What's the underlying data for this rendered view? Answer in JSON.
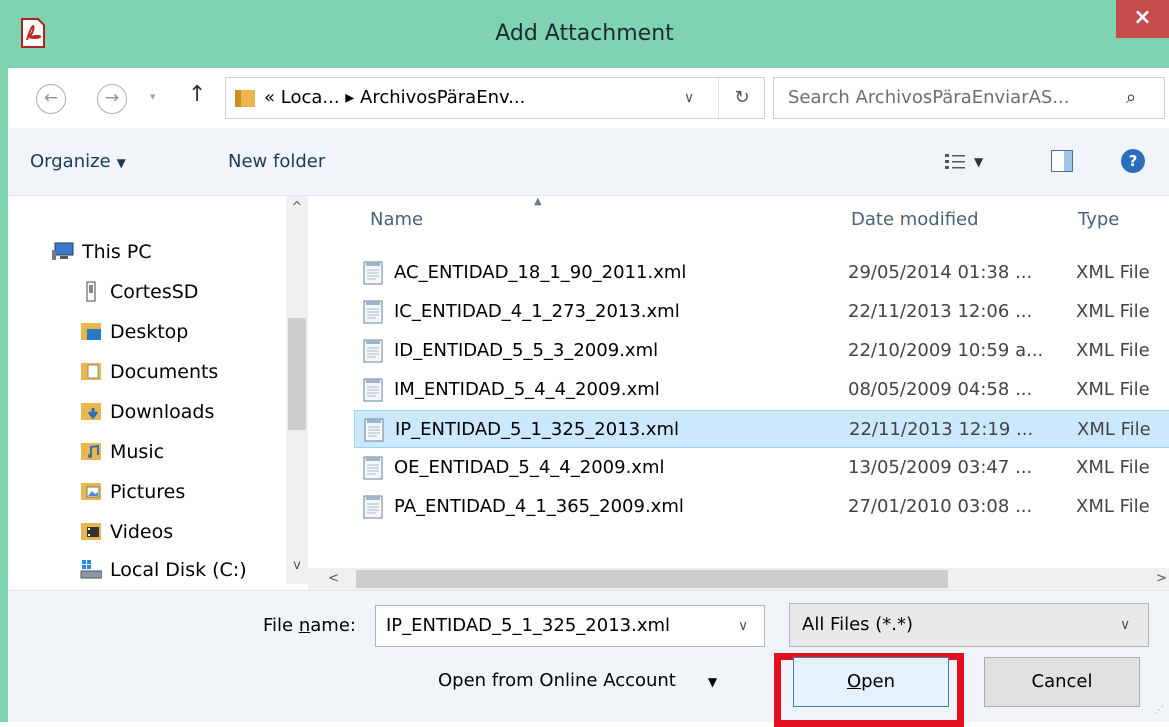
{
  "window": {
    "title": "Add Attachment",
    "close_glyph": "×",
    "app_icon": "pdf-document-icon",
    "accent": "#7fd3b0"
  },
  "navigation": {
    "back_glyph": "←",
    "forward_glyph": "→",
    "recent_glyph": "▾",
    "up_glyph": "↑",
    "address_path": "« Loca... ▸ ArchivosPäraEnv...",
    "address_dropdown_glyph": "∨",
    "refresh_glyph": "↻",
    "search_placeholder": "Search ArchivosPäraEnviarAS...",
    "search_glyph": "⌕"
  },
  "toolbar": {
    "organize": "Organize",
    "organize_caret": "▼",
    "new_folder": "New folder",
    "view_caret": "▼",
    "help_glyph": "?"
  },
  "sidebar": {
    "scroll_up": "^",
    "scroll_down": "v",
    "items": [
      {
        "label": "This PC",
        "icon": "computer-icon"
      },
      {
        "label": "CortesSD",
        "icon": "usb-drive-icon"
      },
      {
        "label": "Desktop",
        "icon": "desktop-folder-icon"
      },
      {
        "label": "Documents",
        "icon": "documents-folder-icon"
      },
      {
        "label": "Downloads",
        "icon": "downloads-folder-icon"
      },
      {
        "label": "Music",
        "icon": "music-folder-icon"
      },
      {
        "label": "Pictures",
        "icon": "pictures-folder-icon"
      },
      {
        "label": "Videos",
        "icon": "videos-folder-icon"
      },
      {
        "label": "Local Disk (C:)",
        "icon": "local-disk-icon"
      }
    ]
  },
  "file_list": {
    "sort_glyph": "▲",
    "columns": {
      "name": "Name",
      "date": "Date modified",
      "type": "Type"
    },
    "rows": [
      {
        "name": "AC_ENTIDAD_18_1_90_2011.xml",
        "date": "29/05/2014 01:38 ...",
        "type": "XML File",
        "selected": false
      },
      {
        "name": "IC_ENTIDAD_4_1_273_2013.xml",
        "date": "22/11/2013 12:06 ...",
        "type": "XML File",
        "selected": false
      },
      {
        "name": "ID_ENTIDAD_5_5_3_2009.xml",
        "date": "22/10/2009 10:59 a...",
        "type": "XML File",
        "selected": false
      },
      {
        "name": "IM_ENTIDAD_5_4_4_2009.xml",
        "date": "08/05/2009 04:58 ...",
        "type": "XML File",
        "selected": false
      },
      {
        "name": "IP_ENTIDAD_5_1_325_2013.xml",
        "date": "22/11/2013 12:19 ...",
        "type": "XML File",
        "selected": true
      },
      {
        "name": "OE_ENTIDAD_5_4_4_2009.xml",
        "date": "13/05/2009 03:47 ...",
        "type": "XML File",
        "selected": false
      },
      {
        "name": "PA_ENTIDAD_4_1_365_2009.xml",
        "date": "27/01/2010 03:08 ...",
        "type": "XML File",
        "selected": false
      }
    ],
    "hscroll_left": "<",
    "hscroll_right": ">"
  },
  "footer": {
    "file_name_label_pre": "File ",
    "file_name_label_accel": "n",
    "file_name_label_post": "ame:",
    "file_name_value": "IP_ENTIDAD_5_1_325_2013.xml",
    "file_name_chevron": "∨",
    "filter_value": "All Files (*.*)",
    "filter_chevron": "∨",
    "online_account": "Open from Online Account",
    "online_caret": "▼",
    "open_accel": "O",
    "open_rest": "pen",
    "cancel": "Cancel",
    "grip_glyph": "⋰",
    "highlight_color": "#e0101e"
  }
}
